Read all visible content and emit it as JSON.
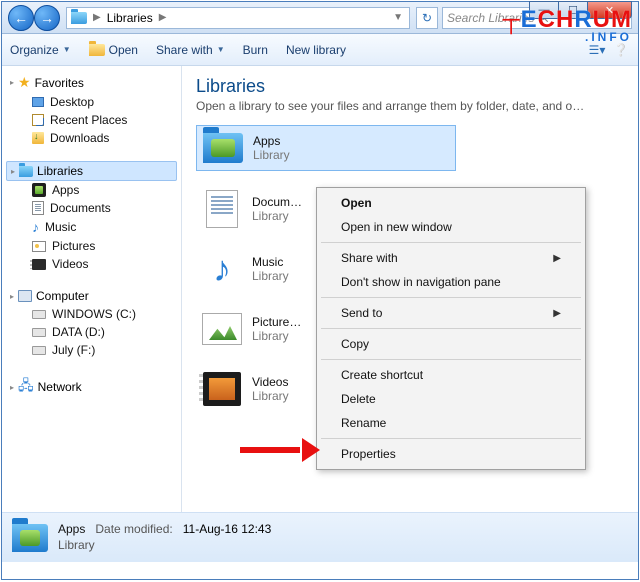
{
  "titlebar": {
    "path": "Libraries",
    "search_placeholder": "Search Libraries"
  },
  "toolbar": {
    "organize": "Organize",
    "open": "Open",
    "share": "Share with",
    "burn": "Burn",
    "newlib": "New library"
  },
  "tree": {
    "favorites": "Favorites",
    "fav_items": [
      "Desktop",
      "Recent Places",
      "Downloads"
    ],
    "libraries": "Libraries",
    "lib_items": [
      "Apps",
      "Documents",
      "Music",
      "Pictures",
      "Videos"
    ],
    "computer": "Computer",
    "drives": [
      "WINDOWS (C:)",
      "DATA (D:)",
      "July (F:)"
    ],
    "network": "Network"
  },
  "content": {
    "title": "Libraries",
    "subtitle": "Open a library to see your files and arrange them by folder, date, and o…",
    "items": [
      {
        "name": "Apps",
        "sub": "Library"
      },
      {
        "name": "Documents",
        "sub": "Library"
      },
      {
        "name": "Music",
        "sub": "Library"
      },
      {
        "name": "Pictures",
        "sub": "Library"
      },
      {
        "name": "Videos",
        "sub": "Library"
      }
    ]
  },
  "context_menu": {
    "open": "Open",
    "open_new": "Open in new window",
    "share": "Share with",
    "hide_nav": "Don't show in navigation pane",
    "sendto": "Send to",
    "copy": "Copy",
    "shortcut": "Create shortcut",
    "delete": "Delete",
    "rename": "Rename",
    "properties": "Properties"
  },
  "details": {
    "name": "Apps",
    "type": "Library",
    "mod_label": "Date modified:",
    "mod_value": "11-Aug-16 12:43"
  },
  "brand": {
    "line1": "TECHRUM",
    "line2": ".INFO"
  }
}
